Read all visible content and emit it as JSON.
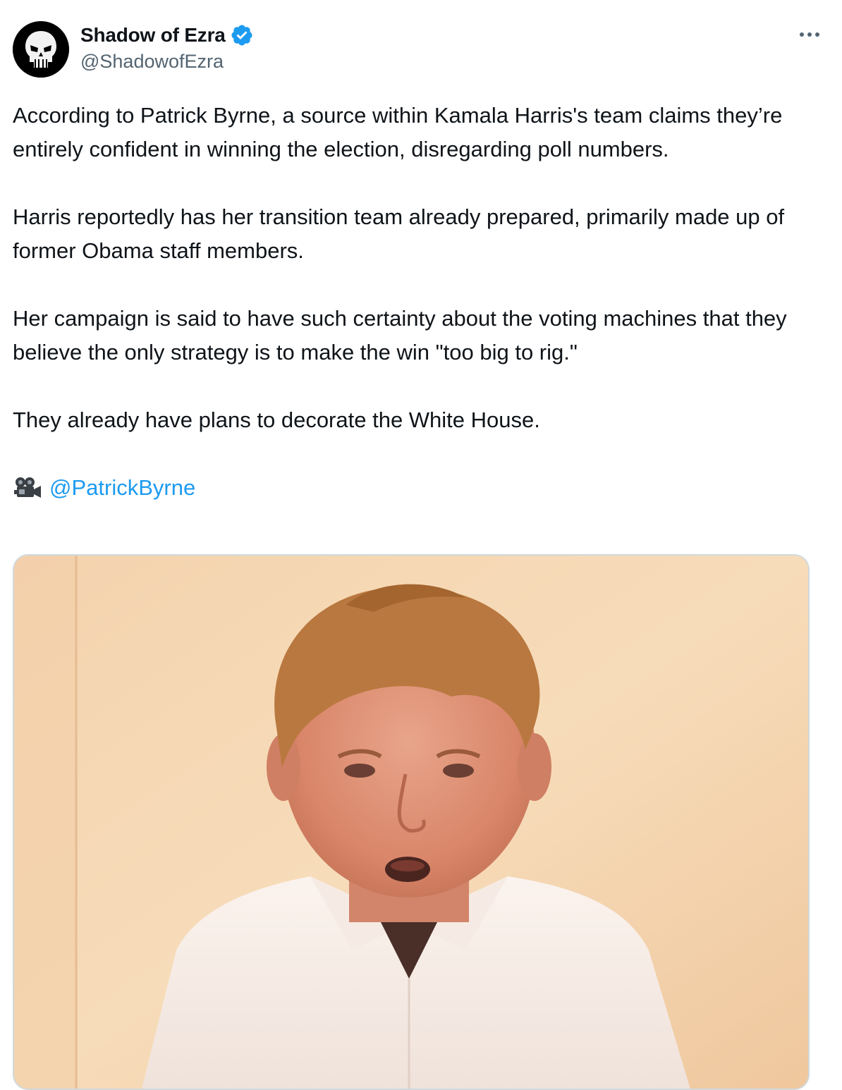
{
  "tweet": {
    "author": {
      "display_name": "Shadow of Ezra",
      "handle": "@ShadowofEzra",
      "verified": true,
      "avatar_icon": "punisher-skull-avatar"
    },
    "more_icon": "more-horizontal-icon",
    "paragraphs": [
      "According to Patrick Byrne, a source within Kamala Harris's team claims they’re entirely confident in winning the election, disregarding poll numbers.",
      "Harris reportedly has her transition team already prepared, primarily made up of former Obama staff members.",
      "Her campaign is said to have such certainty about the voting machines that they believe the only strategy is to make the win \"too big to rig.\"",
      "They already have plans to decorate the White House."
    ],
    "credit": {
      "icon": "movie-camera-icon",
      "mention": "@PatrickByrne"
    },
    "media": {
      "type": "video-thumbnail"
    }
  },
  "colors": {
    "text": "#0f1419",
    "secondary": "#536471",
    "link": "#1d9bf0",
    "verified": "#1d9bf0",
    "border": "#cfd9de"
  }
}
